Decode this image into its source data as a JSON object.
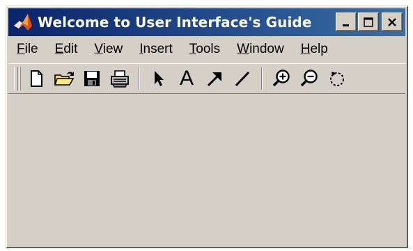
{
  "window": {
    "title": "Welcome to User Interface's Guide",
    "controls": {
      "minimize": "_",
      "maximize": "□",
      "close": "×"
    }
  },
  "menubar": {
    "items": [
      {
        "label_m": "F",
        "label_rest": "ile"
      },
      {
        "label_m": "E",
        "label_rest": "dit"
      },
      {
        "label_m": "V",
        "label_rest": "iew"
      },
      {
        "label_m": "I",
        "label_rest": "nsert"
      },
      {
        "label_m": "T",
        "label_rest": "ools"
      },
      {
        "label_m": "W",
        "label_rest": "indow"
      },
      {
        "label_m": "H",
        "label_rest": "elp"
      }
    ]
  },
  "toolbar": {
    "icons": [
      "new-file-icon",
      "open-folder-icon",
      "save-disk-icon",
      "print-icon",
      "select-arrow-icon",
      "insert-text-icon",
      "insert-arrow-icon",
      "insert-line-icon",
      "zoom-in-icon",
      "zoom-out-icon",
      "rotate-icon"
    ],
    "text_tool_glyph": "A"
  },
  "colors": {
    "title_start": "#0a246a",
    "title_end": "#3a6ea5",
    "face": "#d4d0c8"
  }
}
